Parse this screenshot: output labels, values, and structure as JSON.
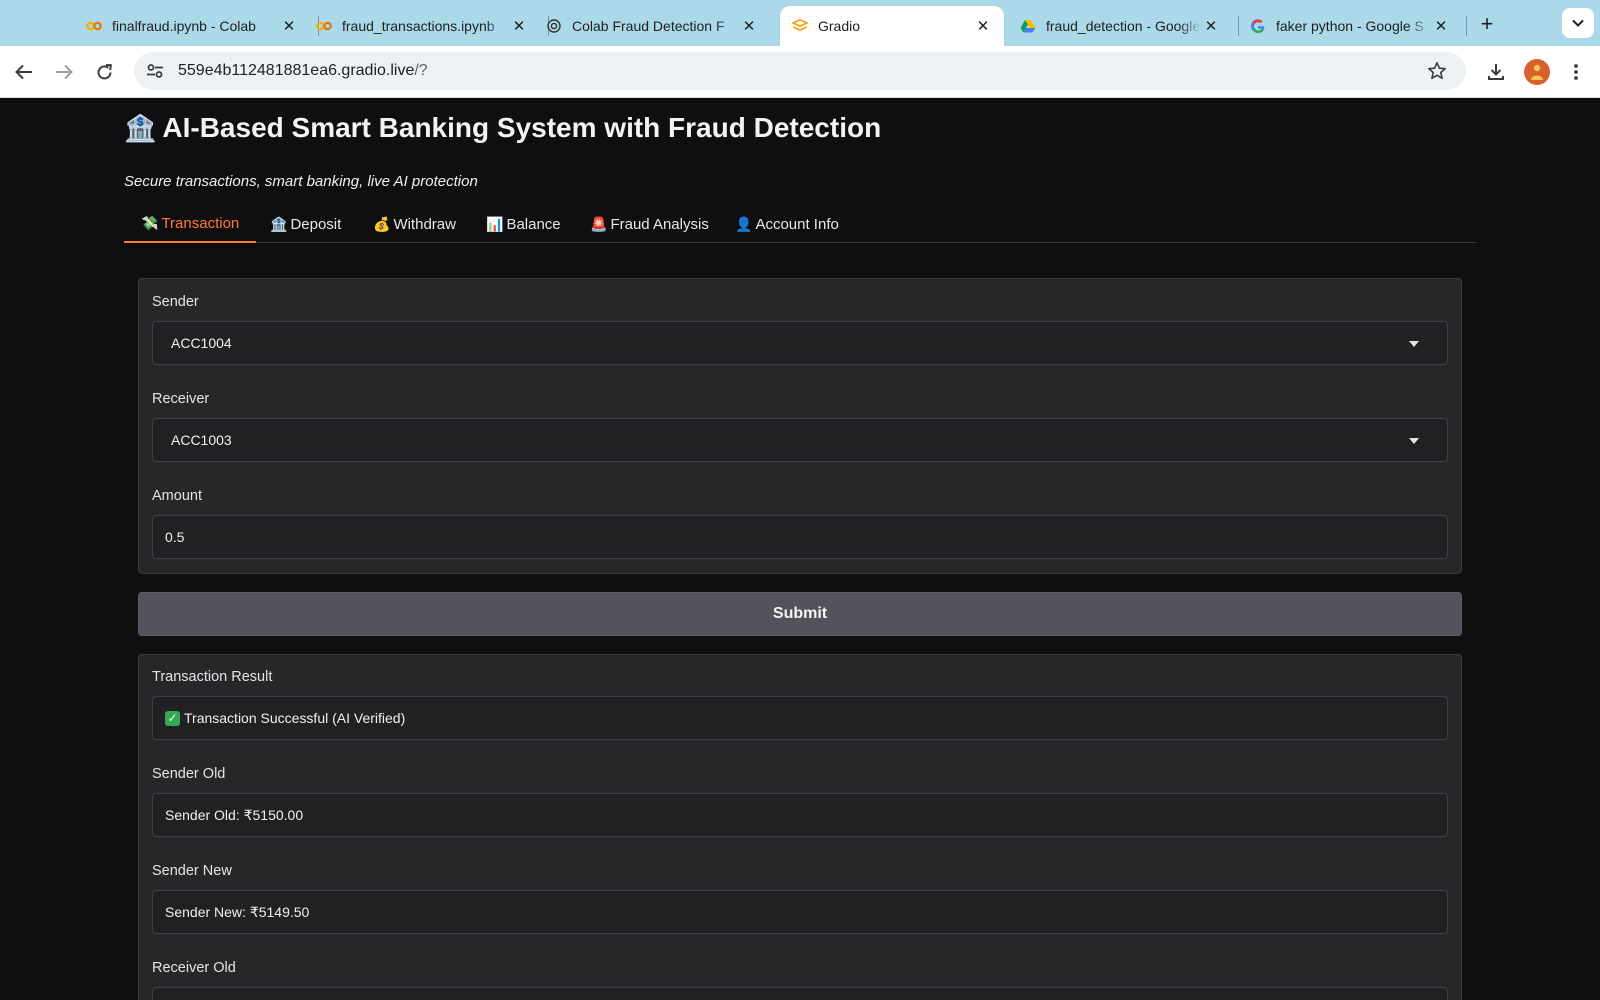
{
  "browser": {
    "tabs": [
      {
        "title": "finalfraud.ipynb - Colab",
        "icon": "colab-icon",
        "active": false
      },
      {
        "title": "fraud_transactions.ipynb",
        "icon": "colab-icon",
        "active": false
      },
      {
        "title": "Colab Fraud Detection F",
        "icon": "openai-icon",
        "active": false
      },
      {
        "title": "Gradio",
        "icon": "gradio-icon",
        "active": true
      },
      {
        "title": "fraud_detection - Google",
        "icon": "google-drive-icon",
        "active": false
      },
      {
        "title": "faker python - Google S",
        "icon": "google-icon",
        "active": false
      }
    ],
    "url_host": "559e4b112481881ea6.gradio.live",
    "url_path": "/?"
  },
  "app": {
    "title_emoji": "🏦",
    "title": "AI-Based Smart Banking System with Fraud Detection",
    "subtitle": "Secure transactions, smart banking, live AI protection",
    "tabs": [
      {
        "icon": "💸",
        "label": "Transaction"
      },
      {
        "icon": "🏦",
        "label": "Deposit"
      },
      {
        "icon": "💰",
        "label": "Withdraw"
      },
      {
        "icon": "📊",
        "label": "Balance"
      },
      {
        "icon": "🚨",
        "label": "Fraud Analysis"
      },
      {
        "icon": "👤",
        "label": "Account Info"
      }
    ],
    "form": {
      "sender_label": "Sender",
      "sender_value": "ACC1004",
      "receiver_label": "Receiver",
      "receiver_value": "ACC1003",
      "amount_label": "Amount",
      "amount_value": "0.5"
    },
    "submit_label": "Submit",
    "results": {
      "result_label": "Transaction Result",
      "result_value": "Transaction Successful (AI Verified)",
      "sender_old_label": "Sender Old",
      "sender_old_value": "Sender Old: ₹5150.00",
      "sender_new_label": "Sender New",
      "sender_new_value": "Sender New: ₹5149.50",
      "receiver_old_label": "Receiver Old"
    }
  },
  "colors": {
    "accent": "#ff7a33",
    "tabbar": "#abd9e9",
    "app_background": "#0f0f11",
    "panel": "#27272a"
  }
}
